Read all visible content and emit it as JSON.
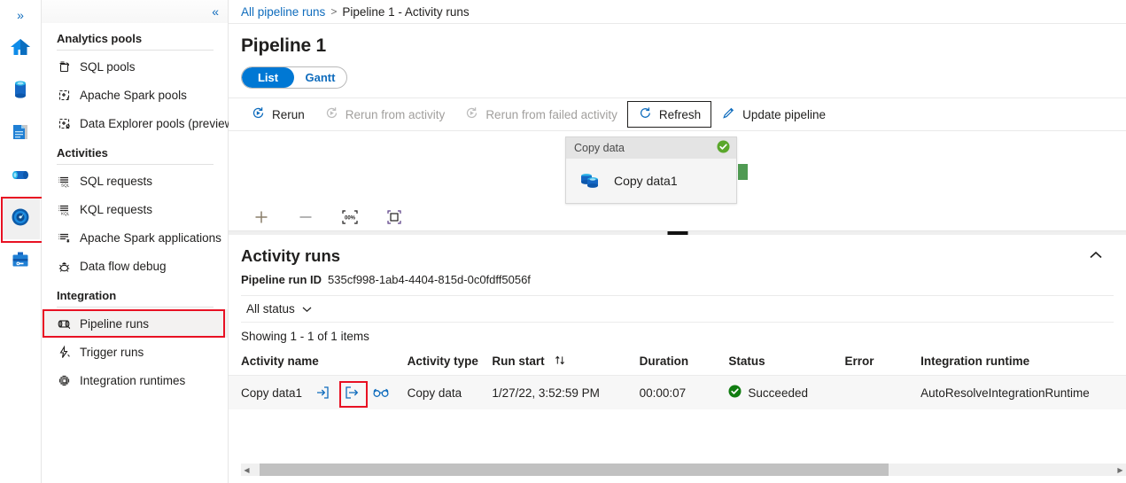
{
  "rail": {
    "expand_label": "»",
    "items": [
      {
        "name": "home",
        "label": "Home"
      },
      {
        "name": "data",
        "label": "Data"
      },
      {
        "name": "develop",
        "label": "Develop"
      },
      {
        "name": "integrate",
        "label": "Integrate"
      },
      {
        "name": "monitor",
        "label": "Monitor"
      },
      {
        "name": "manage",
        "label": "Manage"
      }
    ],
    "selected": "monitor",
    "selection_highlight_color": "#e81123"
  },
  "sidebar": {
    "collapse_label": "«",
    "groups": [
      {
        "title": "Analytics pools",
        "items": [
          {
            "label": "SQL pools",
            "icon": "sql-pool-icon"
          },
          {
            "label": "Apache Spark pools",
            "icon": "spark-pool-icon"
          },
          {
            "label": "Data Explorer pools (preview)",
            "icon": "data-explorer-pool-icon"
          }
        ]
      },
      {
        "title": "Activities",
        "items": [
          {
            "label": "SQL requests",
            "icon": "sql-request-icon"
          },
          {
            "label": "KQL requests",
            "icon": "kql-request-icon"
          },
          {
            "label": "Apache Spark applications",
            "icon": "spark-application-icon"
          },
          {
            "label": "Data flow debug",
            "icon": "data-flow-debug-icon"
          }
        ]
      },
      {
        "title": "Integration",
        "items": [
          {
            "label": "Pipeline runs",
            "icon": "pipeline-runs-icon",
            "selected": true
          },
          {
            "label": "Trigger runs",
            "icon": "trigger-runs-icon"
          },
          {
            "label": "Integration runtimes",
            "icon": "integration-runtimes-icon"
          }
        ]
      }
    ]
  },
  "breadcrumb": {
    "root": "All pipeline runs",
    "separator": ">",
    "current": "Pipeline 1 - Activity runs"
  },
  "page": {
    "title": "Pipeline 1"
  },
  "view_toggle": {
    "list": "List",
    "gantt": "Gantt",
    "active": "List",
    "active_color": "#0078d4"
  },
  "toolbar": {
    "rerun": "Rerun",
    "rerun_from_activity": "Rerun from activity",
    "rerun_from_failed_activity": "Rerun from failed activity",
    "refresh": "Refresh",
    "update_pipeline": "Update pipeline"
  },
  "canvas": {
    "node": {
      "type_label": "Copy data",
      "name": "Copy data1",
      "status": "succeeded",
      "status_color": "#5aa72b",
      "port_color": "#4f9a52"
    },
    "zoom_controls": {
      "zoom_in": "+",
      "zoom_out": "−",
      "zoom_to_fit_label": "00%",
      "fit_to_screen_label": "fit-to-screen"
    }
  },
  "activity_runs": {
    "title": "Activity runs",
    "run_id_label": "Pipeline run ID",
    "run_id_value": "535cf998-1ab4-4404-815d-0c0fdff5056f",
    "status_filter": "All status",
    "showing": "Showing 1 - 1 of 1 items",
    "columns": [
      "Activity name",
      "Activity type",
      "Run start",
      "Duration",
      "Status",
      "Error",
      "Integration runtime"
    ],
    "sort_column": "Run start",
    "rows": [
      {
        "activity_name": "Copy data1",
        "activity_type": "Copy data",
        "run_start": "1/27/22, 3:52:59 PM",
        "duration": "00:00:07",
        "status": "Succeeded",
        "status_color": "#107c10",
        "error": "",
        "integration_runtime": "AutoResolveIntegrationRuntime",
        "icons": {
          "input": "input-icon",
          "output": "output-icon",
          "details": "details-glasses-icon",
          "highlighted": "output-icon"
        }
      }
    ]
  }
}
